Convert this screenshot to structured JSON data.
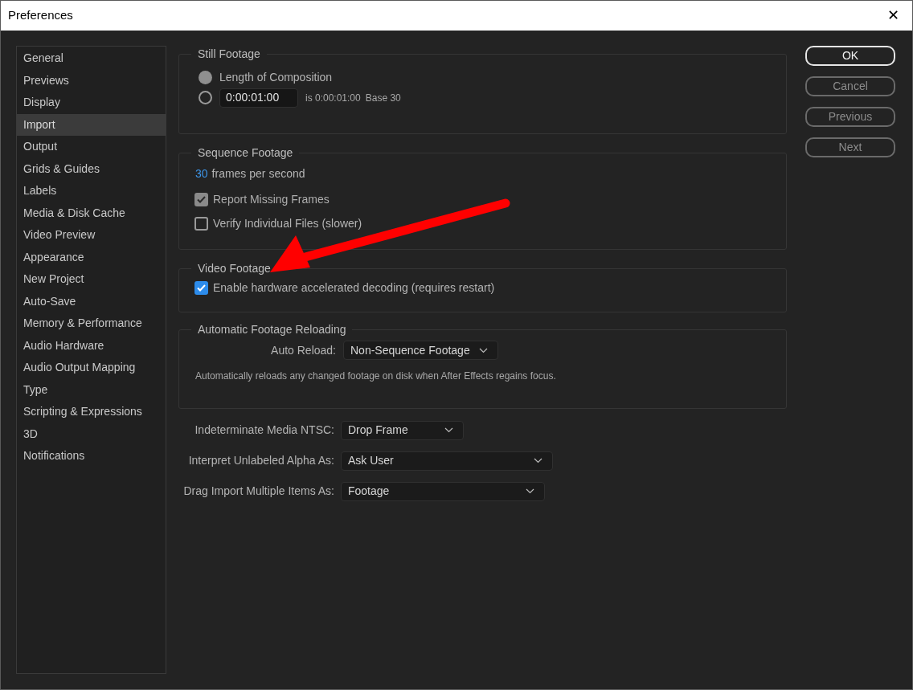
{
  "window": {
    "title": "Preferences",
    "close": "✕"
  },
  "sidebar": {
    "items": [
      {
        "label": "General",
        "selected": false
      },
      {
        "label": "Previews",
        "selected": false
      },
      {
        "label": "Display",
        "selected": false
      },
      {
        "label": "Import",
        "selected": true
      },
      {
        "label": "Output",
        "selected": false
      },
      {
        "label": "Grids & Guides",
        "selected": false
      },
      {
        "label": "Labels",
        "selected": false
      },
      {
        "label": "Media & Disk Cache",
        "selected": false
      },
      {
        "label": "Video Preview",
        "selected": false
      },
      {
        "label": "Appearance",
        "selected": false
      },
      {
        "label": "New Project",
        "selected": false
      },
      {
        "label": "Auto-Save",
        "selected": false
      },
      {
        "label": "Memory & Performance",
        "selected": false
      },
      {
        "label": "Audio Hardware",
        "selected": false
      },
      {
        "label": "Audio Output Mapping",
        "selected": false
      },
      {
        "label": "Type",
        "selected": false
      },
      {
        "label": "Scripting & Expressions",
        "selected": false
      },
      {
        "label": "3D",
        "selected": false
      },
      {
        "label": "Notifications",
        "selected": false
      }
    ]
  },
  "still_footage": {
    "title": "Still Footage",
    "options": [
      {
        "kind": "label",
        "label": "Length of Composition",
        "selected": true
      },
      {
        "kind": "duration",
        "value": "0:00:01:00",
        "note": "is 0:00:01:00",
        "base": "Base 30",
        "selected": false
      }
    ]
  },
  "sequence_footage": {
    "title": "Sequence Footage",
    "fps_value": "30",
    "fps_label": "frames per second",
    "checkboxes": [
      {
        "label": "Report Missing Frames",
        "checked": true,
        "disabled": true
      },
      {
        "label": "Verify Individual Files (slower)",
        "checked": false,
        "disabled": false
      }
    ]
  },
  "video_footage": {
    "title": "Video Footage",
    "checkboxes": [
      {
        "label": "Enable hardware accelerated decoding (requires restart)",
        "checked": true,
        "disabled": false
      }
    ]
  },
  "auto_reload": {
    "title": "Automatic Footage Reloading",
    "label": "Auto Reload:",
    "value": "Non-Sequence Footage",
    "note": "Automatically reloads any changed footage on disk when After Effects regains focus."
  },
  "dropdowns": [
    {
      "label": "Indeterminate Media NTSC:",
      "value": "Drop Frame"
    },
    {
      "label": "Interpret Unlabeled Alpha As:",
      "value": "Ask User"
    },
    {
      "label": "Drag Import Multiple Items As:",
      "value": "Footage"
    }
  ],
  "buttons": [
    {
      "label": "OK",
      "default": true
    },
    {
      "label": "Cancel",
      "default": false
    },
    {
      "label": "Previous",
      "default": false
    },
    {
      "label": "Next",
      "default": false
    }
  ]
}
